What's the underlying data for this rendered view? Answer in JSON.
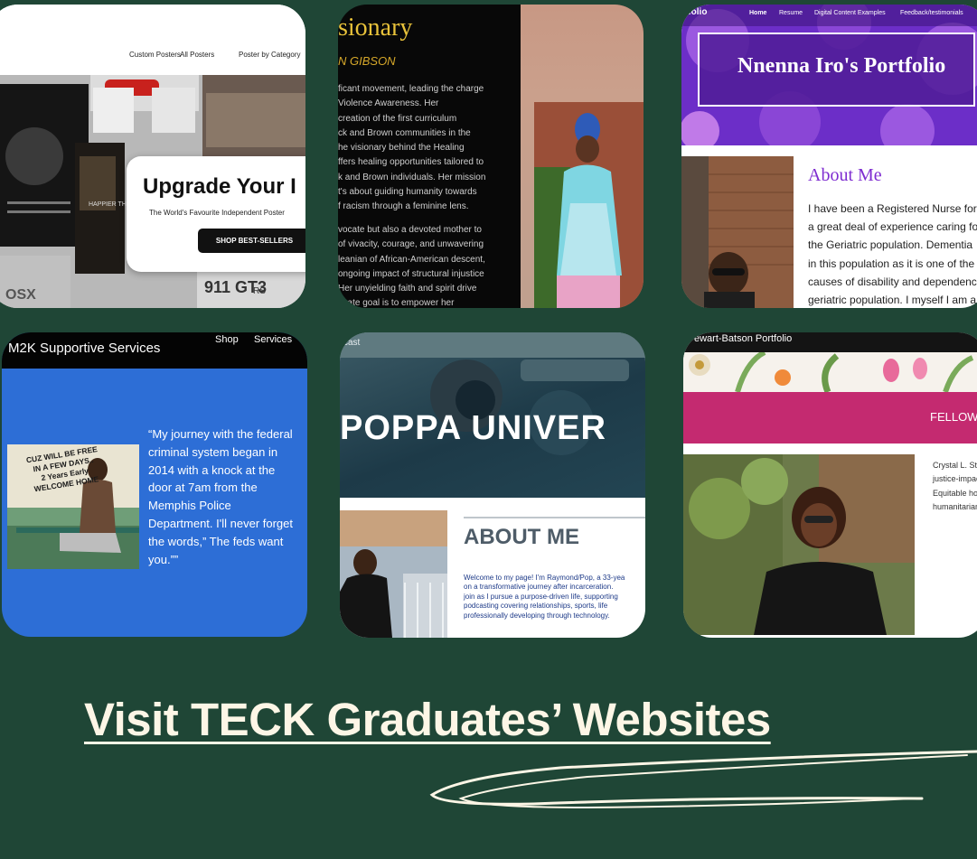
{
  "heading": "Visit TECK Graduates’ Websites",
  "cards": {
    "posters": {
      "nav": [
        "Custom Posters",
        "All Posters",
        "Poster by Category"
      ],
      "popup_title": "Upgrade Your I",
      "popup_subtitle": "The World's Favourite Independent Poster",
      "popup_button": "SHOP BEST-SELLERS",
      "poster_texts": [
        "HAPPIER THAN",
        "911 GT3",
        "RS",
        "OSX"
      ]
    },
    "visionary": {
      "title": "sionary",
      "name": "N GIBSON",
      "para1": [
        "ficant movement, leading the charge",
        "Violence Awareness. Her",
        "creation of the first curriculum",
        "ck and Brown communities in the",
        "he visionary behind the Healing",
        "ffers healing opportunities tailored to",
        "k and Brown individuals. Her mission",
        "t's about guiding humanity towards",
        "f racism through a feminine lens."
      ],
      "para2": [
        "vocate but also a devoted mother to",
        "of vivacity, courage, and unwavering",
        "leanian of African-American descent,",
        "ongoing impact of structural injustice",
        "Her unyielding faith and spirit drive",
        "imate goal is to empower her"
      ]
    },
    "nnenna": {
      "logo": "tfolio",
      "nav": [
        "Home",
        "Resume",
        "Digital Content Examples",
        "Feedback/testimonials"
      ],
      "title": "Nnenna Iro's Portfolio",
      "about": "About Me",
      "lines": [
        "I have been a Registered Nurse for",
        "a great deal of experience caring fo",
        "the Geriatric population. Dementia",
        "in this population as it is one of the",
        "causes of disability and dependenc",
        "geriatric population. I myself I am a"
      ]
    },
    "m2k": {
      "brand": "M2K Supportive Services",
      "nav": [
        "Shop",
        "Services"
      ],
      "sign_text": [
        "CUZ WILL BE FREE",
        "IN A FEW DAYS..",
        "2 Years Early",
        "WELCOME HOME"
      ],
      "quote": [
        "“My journey with the federal",
        "criminal system began in",
        "2014 with a knock at the",
        "door at 7am from the",
        "Memphis Police",
        "Department. I'll never forget",
        "the words,” The feds want",
        "you.””"
      ]
    },
    "poppa": {
      "tag": "cast",
      "title": "POPPA UNIVER",
      "about": "ABOUT ME",
      "welcome": [
        "Welcome to my page! I'm Raymond/Pop, a 33-yea",
        "on a transformative journey after incarceration.",
        "join as I pursue a purpose-driven life, supporting",
        "podcasting covering relationships, sports, life",
        "professionally developing through technology."
      ]
    },
    "stewart": {
      "title": "ewart-Batson Portfolio",
      "banner": "FELLOW",
      "text": [
        "Crystal L. Ste",
        "justice-impac",
        "Equitable ho",
        "humanitarian"
      ]
    }
  },
  "colors": {
    "background": "#1f4636",
    "heading": "#fdf6e6",
    "m2k_blue": "#2d6ed6",
    "nnenna_purple": "#6c2ec8",
    "stewart_magenta": "#c42a70",
    "visionary_gold": "#e8c23a"
  }
}
